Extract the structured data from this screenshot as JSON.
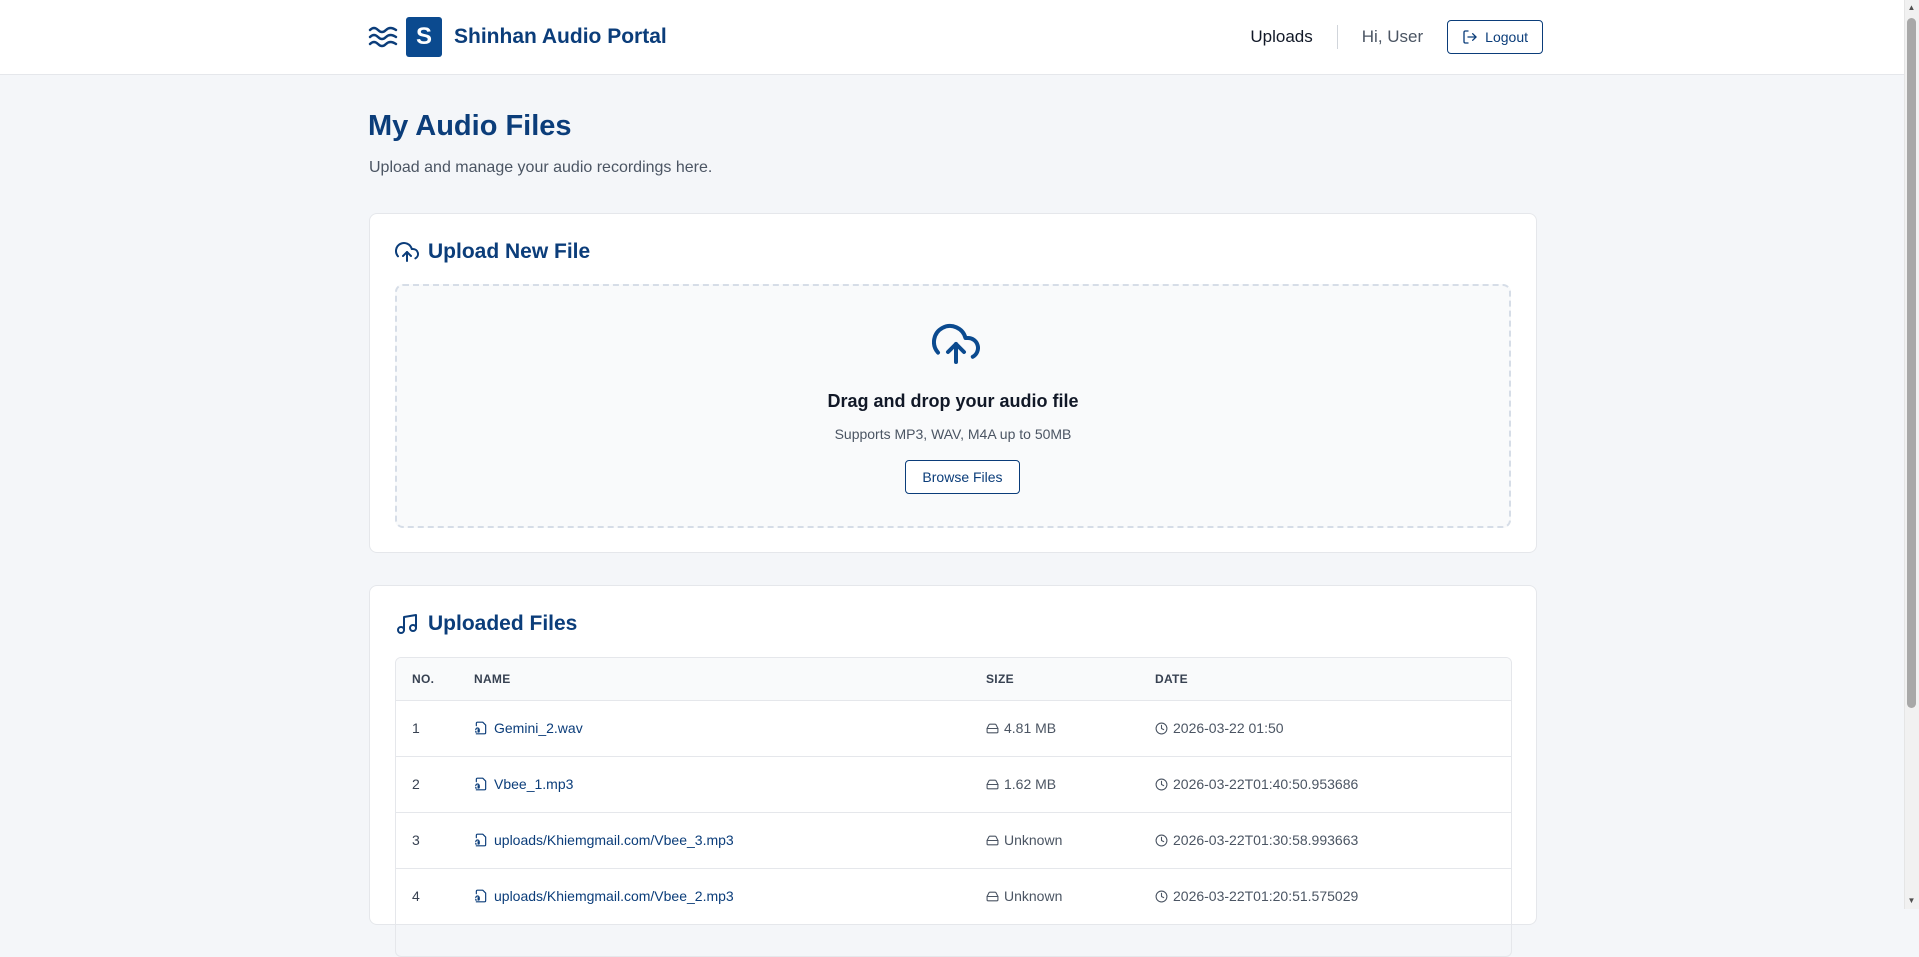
{
  "header": {
    "brand_letter": "S",
    "brand_name": "Shinhan Audio Portal",
    "nav_uploads": "Uploads",
    "greeting": "Hi, User",
    "logout_label": "Logout"
  },
  "page": {
    "title": "My Audio Files",
    "subtitle": "Upload and manage your audio recordings here."
  },
  "upload": {
    "title": "Upload New File",
    "drop_title": "Drag and drop your audio file",
    "drop_sub": "Supports MP3, WAV, M4A up to 50MB",
    "browse_label": "Browse Files"
  },
  "files": {
    "title": "Uploaded Files",
    "columns": [
      "NO.",
      "NAME",
      "SIZE",
      "DATE"
    ],
    "rows": [
      {
        "no": "1",
        "name": "Gemini_2.wav",
        "size": "4.81 MB",
        "date": "2026-03-22 01:50"
      },
      {
        "no": "2",
        "name": "Vbee_1.mp3",
        "size": "1.62 MB",
        "date": "2026-03-22T01:40:50.953686"
      },
      {
        "no": "3",
        "name": "uploads/Khiemgmail.com/Vbee_3.mp3",
        "size": "Unknown",
        "date": "2026-03-22T01:30:58.993663"
      },
      {
        "no": "4",
        "name": "uploads/Khiemgmail.com/Vbee_2.mp3",
        "size": "Unknown",
        "date": "2026-03-22T01:20:51.575029"
      }
    ]
  },
  "colors": {
    "brand": "#0b3d7a",
    "logo_bg": "#0b4a8f",
    "page_bg": "#f4f6f9"
  }
}
